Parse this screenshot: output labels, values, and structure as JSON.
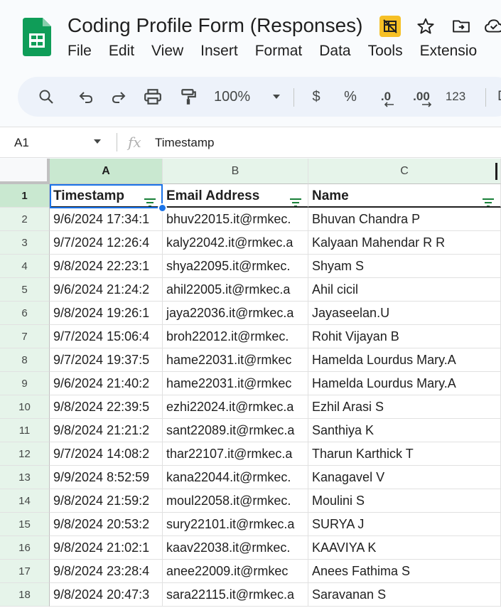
{
  "app": {
    "title": "Coding Profile Form (Responses)",
    "menu": [
      "File",
      "Edit",
      "View",
      "Insert",
      "Format",
      "Data",
      "Tools",
      "Extensio"
    ]
  },
  "toolbar": {
    "zoom": "100%",
    "currency": "$",
    "percent": "%",
    "decrease_decimal": ".0",
    "increase_decimal": ".00",
    "number_format": "123",
    "overflow": "D"
  },
  "formula_bar": {
    "cell_ref": "A1",
    "fx": "fx",
    "content": "Timestamp"
  },
  "sheet": {
    "columns": [
      "A",
      "B",
      "C"
    ],
    "headers": [
      "Timestamp",
      "Email Address",
      "Name"
    ],
    "row_numbers": [
      "1",
      "2",
      "3",
      "4",
      "5",
      "6",
      "7",
      "8",
      "9",
      "10",
      "11",
      "12",
      "13",
      "14",
      "15",
      "16",
      "17",
      "18"
    ],
    "rows": [
      [
        "9/6/2024 17:34:1",
        "bhuv22015.it@rmkec.",
        "Bhuvan Chandra P"
      ],
      [
        "9/7/2024 12:26:4",
        "kaly22042.it@rmkec.a",
        "Kalyaan Mahendar R R"
      ],
      [
        "9/8/2024 22:23:1",
        "shya22095.it@rmkec.",
        "Shyam S"
      ],
      [
        "9/6/2024 21:24:2",
        "ahil22005.it@rmkec.a",
        "Ahil cicil"
      ],
      [
        "9/8/2024 19:26:1",
        "jaya22036.it@rmkec.a",
        "Jayaseelan.U"
      ],
      [
        "9/7/2024 15:06:4",
        "broh22012.it@rmkec.",
        "Rohit Vijayan B"
      ],
      [
        "9/7/2024 19:37:5",
        "hame22031.it@rmkec",
        "Hamelda Lourdus Mary.A"
      ],
      [
        "9/6/2024 21:40:2",
        "hame22031.it@rmkec",
        "Hamelda Lourdus Mary.A"
      ],
      [
        "9/8/2024 22:39:5",
        "ezhi22024.it@rmkec.a",
        "Ezhil Arasi S"
      ],
      [
        "9/8/2024 21:21:2",
        "sant22089.it@rmkec.a",
        "Santhiya K"
      ],
      [
        "9/7/2024 14:08:2",
        "thar22107.it@rmkec.a",
        "Tharun Karthick T"
      ],
      [
        "9/9/2024 8:52:59",
        "kana22044.it@rmkec.",
        "Kanagavel V"
      ],
      [
        "9/8/2024 21:59:2",
        "moul22058.it@rmkec.",
        "Moulini S"
      ],
      [
        "9/8/2024 20:53:2",
        "sury22101.it@rmkec.a",
        "SURYA J"
      ],
      [
        "9/8/2024 21:02:1",
        "kaav22038.it@rmkec.",
        "KAAVIYA K"
      ],
      [
        "9/8/2024 23:28:4",
        "anee22009.it@rmkec",
        "Anees Fathima S"
      ],
      [
        "9/8/2024 20:47:3",
        "sara22115.it@rmkec.a",
        "Saravanan S"
      ]
    ]
  },
  "colors": {
    "accent": "#1a73e8",
    "sheets_green": "#0f9d58",
    "filter_green": "#188038",
    "row_header_bg": "#e6f4ea"
  }
}
